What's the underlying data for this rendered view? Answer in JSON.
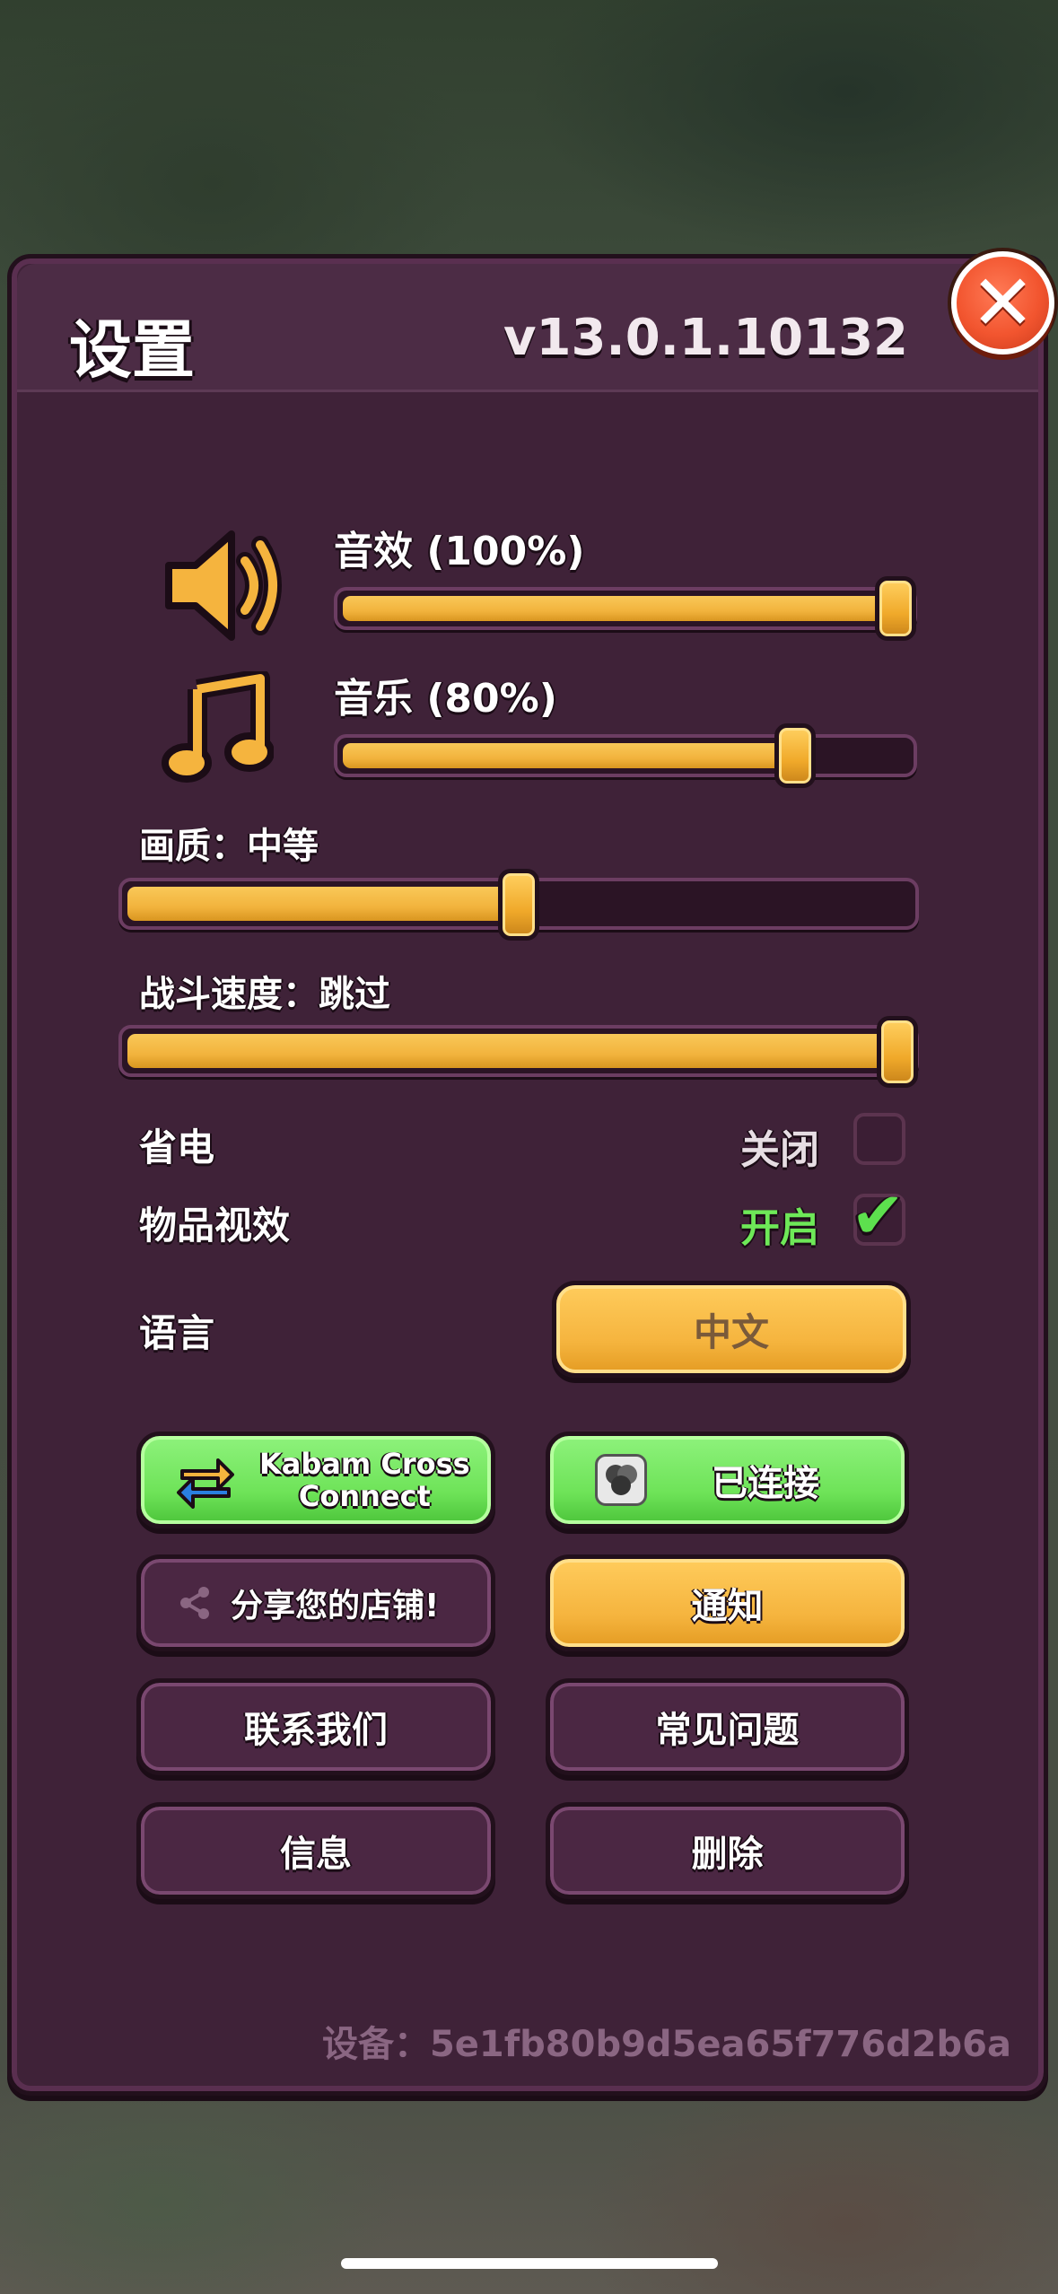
{
  "header": {
    "title": "设置",
    "version": "v13.0.1.10132"
  },
  "sliders": {
    "sound": {
      "label": "音效 (100%)",
      "value_percent": 100
    },
    "music": {
      "label": "音乐 (80%)",
      "value_percent": 80
    },
    "quality": {
      "label": "画质：中等",
      "value_fraction": 0.5
    },
    "battle_speed": {
      "label": "战斗速度：跳过",
      "value_fraction": 1.0
    }
  },
  "toggles": {
    "power_saving": {
      "label": "省电",
      "state": "关闭",
      "checked": false
    },
    "item_effects": {
      "label": "物品视效",
      "state": "开启",
      "checked": true
    }
  },
  "language": {
    "label": "语言",
    "value": "中文"
  },
  "buttons": {
    "kabam_line1": "Kabam Cross",
    "kabam_line2": "Connect",
    "connected": "已连接",
    "share": "分享您的店铺!",
    "notifications": "通知",
    "contact": "联系我们",
    "faq": "常见问题",
    "info": "信息",
    "delete": "删除"
  },
  "device": "设备：5e1fb80b9d5ea65f776d2b6a",
  "colors": {
    "accent_orange": "#f5b43e",
    "accent_green": "#6ee358",
    "panel": "#3f2238",
    "close_red": "#f2552f"
  },
  "icons": [
    "speaker-icon",
    "music-note-icon",
    "close-icon",
    "checkmark-icon",
    "cross-connect-icon",
    "share-icon",
    "connected-account-icon"
  ]
}
